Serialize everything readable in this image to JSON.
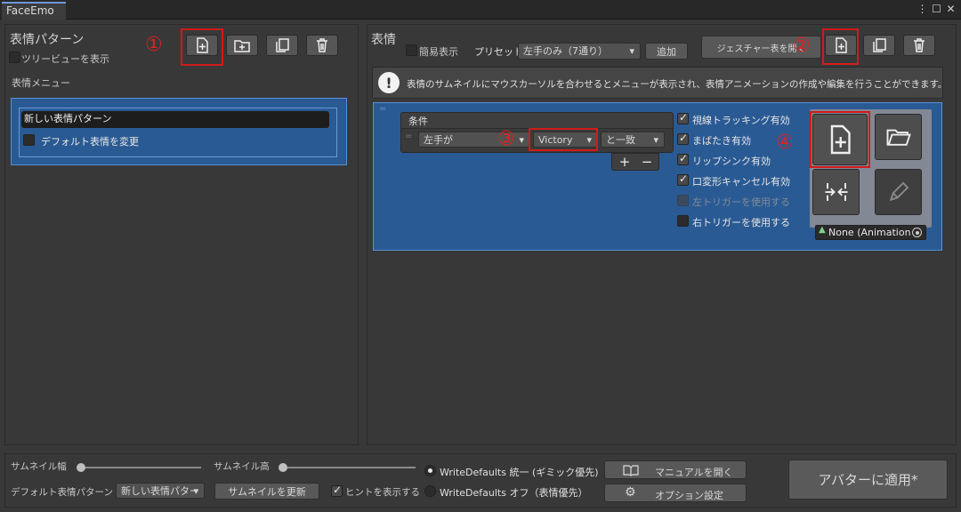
{
  "window": {
    "title": "FaceEmo",
    "more_icon": "⋮",
    "maximize_icon": "☐",
    "close_icon": "✕"
  },
  "left_panel": {
    "title": "表情パターン",
    "tree_view_label": "ツリービューを表示",
    "menu_label": "表情メニュー",
    "menu_items": [
      {
        "name": "新しい表情パターン"
      }
    ],
    "default_change_label": "デフォルト表情を変更",
    "marker": "①"
  },
  "right_panel": {
    "title": "表情",
    "simple_label": "簡易表示",
    "preset_label": "プリセット",
    "preset_value": "左手のみ（7通り）",
    "add_label": "追加",
    "gesture_table_label": "ジェスチャー表を開く",
    "marker": "②",
    "hint": "表情のサムネイルにマウスカーソルを合わせるとメニューが表示され、表情アニメーションの作成や編集を行うことができます。",
    "condition": {
      "header": "条件",
      "hand": "左手が",
      "gesture": "Victory",
      "comparison": "と一致",
      "plus": "+",
      "minus": "−",
      "marker": "③"
    },
    "toggles": [
      {
        "label": "視線トラッキング有効",
        "checked": true,
        "enabled": true
      },
      {
        "label": "まばたき有効",
        "checked": true,
        "enabled": true
      },
      {
        "label": "リップシンク有効",
        "checked": true,
        "enabled": true
      },
      {
        "label": "口変形キャンセル有効",
        "checked": true,
        "enabled": true
      },
      {
        "label": "左トリガーを使用する",
        "checked": false,
        "enabled": false
      },
      {
        "label": "右トリガーを使用する",
        "checked": false,
        "enabled": true
      }
    ],
    "animation_label": "None (Animation",
    "marker4": "④"
  },
  "bottom": {
    "thumb_width_label": "サムネイル幅",
    "thumb_height_label": "サムネイル高",
    "default_pattern_label": "デフォルト表情パターン",
    "default_pattern_value": "新しい表情パター",
    "refresh_thumbs_label": "サムネイルを更新",
    "show_hints_label": "ヒントを表示する",
    "wd_on_label": "WriteDefaults 統一 (ギミック優先)",
    "wd_off_label": "WriteDefaults オフ（表情優先）",
    "manual_label": "マニュアルを開く",
    "options_label": "オプション設定",
    "apply_label": "アバターに適用*"
  },
  "colors": {
    "accent_blue": "#2a5a93",
    "selection_border": "#5591d4",
    "marker_red": "#e02020",
    "background": "#383838"
  }
}
